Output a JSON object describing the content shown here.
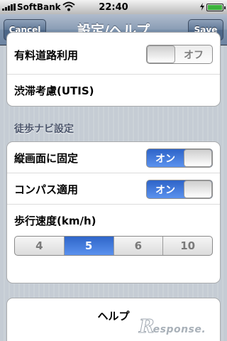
{
  "status_bar": {
    "carrier": "SoftBank",
    "time": "22:40",
    "icons": [
      "signal-bars-icon",
      "wifi-icon",
      "charging-bolt-icon",
      "battery-icon"
    ],
    "battery_color": "#3db33d"
  },
  "nav": {
    "title": "設定/ヘルプ",
    "cancel_label": "Cancel",
    "save_label": "Save"
  },
  "road_settings": {
    "toll_road": {
      "label": "有料道路利用",
      "switch_state": "off",
      "switch_text": "オフ"
    },
    "traffic": {
      "label": "渋滞考慮(UTIS)"
    }
  },
  "walk_section": {
    "header": "徒歩ナビ設定",
    "portrait_lock": {
      "label": "縦画面に固定",
      "switch_state": "on",
      "switch_text": "オン"
    },
    "compass": {
      "label": "コンパス適用",
      "switch_state": "on",
      "switch_text": "オン"
    },
    "walking_speed": {
      "label": "歩行速度(km/h)",
      "options": [
        "4",
        "5",
        "6",
        "10"
      ],
      "selected": "5"
    }
  },
  "help": {
    "label": "ヘルプ"
  },
  "watermark": {
    "logo_letter": "R",
    "text": "esponse."
  },
  "colors": {
    "nav_bar": "#7990ab",
    "switch_on": "#3a74dc",
    "section_header": "#4c566c"
  }
}
